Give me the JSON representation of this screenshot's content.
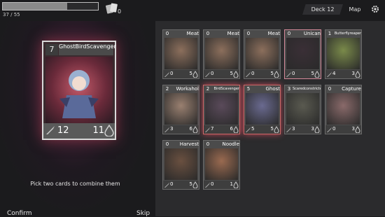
{
  "topbar": {
    "hp_text": "37 / 55",
    "hp_fraction": 0.673,
    "deck_count": "0",
    "deck_label": "Deck 12",
    "map_label": "Map"
  },
  "preview": {
    "cost": "7",
    "name": "GhostBirdScavenger",
    "attack": "12",
    "health": "11",
    "hint": "Pick two cards to combine them",
    "confirm_label": "Confirm",
    "skip_label": "Skip"
  },
  "cards": [
    {
      "cost": "0",
      "name": "Meat",
      "attack": "0",
      "health": "5",
      "art": "#8c6f5c"
    },
    {
      "cost": "0",
      "name": "Meat",
      "attack": "0",
      "health": "5",
      "art": "#8c6f5c"
    },
    {
      "cost": "0",
      "name": "Meat",
      "attack": "0",
      "health": "5",
      "art": "#8c6f5c"
    },
    {
      "cost": "0",
      "name": "Unican",
      "attack": "0",
      "health": "5",
      "art": "#3a2f36"
    },
    {
      "cost": "1",
      "name": "Butterflyreaper",
      "attack": "4",
      "health": "3",
      "art": "#7a8a4a"
    },
    {
      "cost": "2",
      "name": "Workahol",
      "attack": "3",
      "health": "6",
      "art": "#9a8070"
    },
    {
      "cost": "2",
      "name": "BirdScavenger",
      "attack": "7",
      "health": "6",
      "art": "#5a4a5a"
    },
    {
      "cost": "5",
      "name": "Ghost",
      "attack": "5",
      "health": "5",
      "art": "#6a6a90"
    },
    {
      "cost": "3",
      "name": "Scaredconstricter",
      "attack": "3",
      "health": "3",
      "art": "#5a5a50"
    },
    {
      "cost": "0",
      "name": "Capture",
      "attack": "0",
      "health": "3",
      "art": "#8a6a6a"
    },
    {
      "cost": "0",
      "name": "Harvest",
      "attack": "0",
      "health": "5",
      "art": "#6a5040"
    },
    {
      "cost": "0",
      "name": "Noodle",
      "attack": "0",
      "health": "1",
      "art": "#9a6a50"
    }
  ]
}
